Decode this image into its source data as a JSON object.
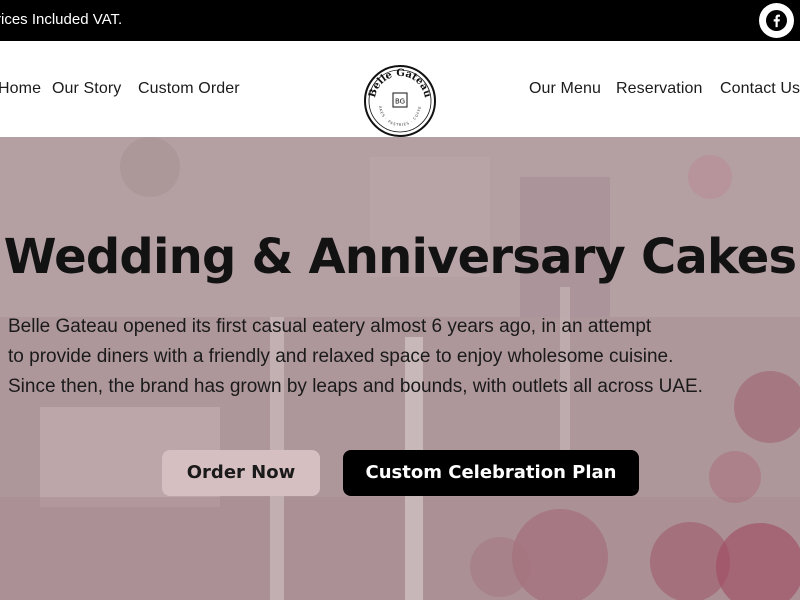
{
  "topbar": {
    "message": "Prices Included VAT.",
    "social_icon": "facebook-icon"
  },
  "nav": {
    "left": [
      "Home",
      "Our Story",
      "Custom Order"
    ],
    "right": [
      "Our Menu",
      "Reservation",
      "Contact Us"
    ],
    "logo": {
      "brand": "Belle Gateau",
      "monogram": "BG",
      "tagline": "CAKES · PASTRIES · COFFEE"
    }
  },
  "hero": {
    "title": "Wedding & Anniversary Cakes",
    "description": [
      "Belle Gateau opened its first casual eatery almost 6 years ago, in an attempt",
      "to provide diners with a friendly and relaxed space to enjoy wholesome cuisine.",
      "Since then, the brand has grown by leaps and bounds, with outlets all across UAE."
    ],
    "buttons": {
      "primary": "Order Now",
      "secondary": "Custom Celebration Plan"
    }
  },
  "colors": {
    "topbar": "#000000",
    "overlay": "#b29c9f",
    "order_button": "#d6bfc1",
    "plan_button": "#000000"
  }
}
